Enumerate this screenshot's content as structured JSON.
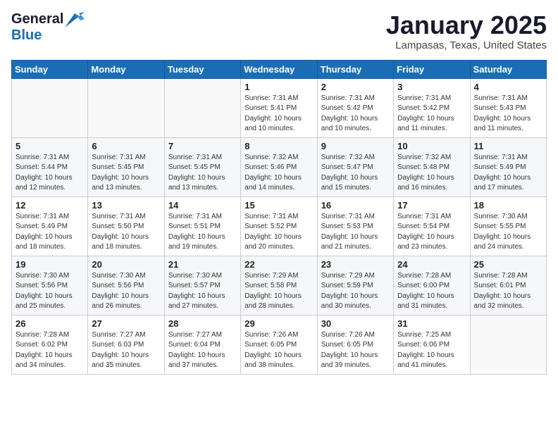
{
  "logo": {
    "general": "General",
    "blue": "Blue"
  },
  "title": "January 2025",
  "subtitle": "Lampasas, Texas, United States",
  "weekdays": [
    "Sunday",
    "Monday",
    "Tuesday",
    "Wednesday",
    "Thursday",
    "Friday",
    "Saturday"
  ],
  "weeks": [
    [
      {
        "day": "",
        "info": ""
      },
      {
        "day": "",
        "info": ""
      },
      {
        "day": "",
        "info": ""
      },
      {
        "day": "1",
        "info": "Sunrise: 7:31 AM\nSunset: 5:41 PM\nDaylight: 10 hours and 10 minutes."
      },
      {
        "day": "2",
        "info": "Sunrise: 7:31 AM\nSunset: 5:42 PM\nDaylight: 10 hours and 10 minutes."
      },
      {
        "day": "3",
        "info": "Sunrise: 7:31 AM\nSunset: 5:42 PM\nDaylight: 10 hours and 11 minutes."
      },
      {
        "day": "4",
        "info": "Sunrise: 7:31 AM\nSunset: 5:43 PM\nDaylight: 10 hours and 11 minutes."
      }
    ],
    [
      {
        "day": "5",
        "info": "Sunrise: 7:31 AM\nSunset: 5:44 PM\nDaylight: 10 hours and 12 minutes."
      },
      {
        "day": "6",
        "info": "Sunrise: 7:31 AM\nSunset: 5:45 PM\nDaylight: 10 hours and 13 minutes."
      },
      {
        "day": "7",
        "info": "Sunrise: 7:31 AM\nSunset: 5:45 PM\nDaylight: 10 hours and 13 minutes."
      },
      {
        "day": "8",
        "info": "Sunrise: 7:32 AM\nSunset: 5:46 PM\nDaylight: 10 hours and 14 minutes."
      },
      {
        "day": "9",
        "info": "Sunrise: 7:32 AM\nSunset: 5:47 PM\nDaylight: 10 hours and 15 minutes."
      },
      {
        "day": "10",
        "info": "Sunrise: 7:32 AM\nSunset: 5:48 PM\nDaylight: 10 hours and 16 minutes."
      },
      {
        "day": "11",
        "info": "Sunrise: 7:31 AM\nSunset: 5:49 PM\nDaylight: 10 hours and 17 minutes."
      }
    ],
    [
      {
        "day": "12",
        "info": "Sunrise: 7:31 AM\nSunset: 5:49 PM\nDaylight: 10 hours and 18 minutes."
      },
      {
        "day": "13",
        "info": "Sunrise: 7:31 AM\nSunset: 5:50 PM\nDaylight: 10 hours and 18 minutes."
      },
      {
        "day": "14",
        "info": "Sunrise: 7:31 AM\nSunset: 5:51 PM\nDaylight: 10 hours and 19 minutes."
      },
      {
        "day": "15",
        "info": "Sunrise: 7:31 AM\nSunset: 5:52 PM\nDaylight: 10 hours and 20 minutes."
      },
      {
        "day": "16",
        "info": "Sunrise: 7:31 AM\nSunset: 5:53 PM\nDaylight: 10 hours and 21 minutes."
      },
      {
        "day": "17",
        "info": "Sunrise: 7:31 AM\nSunset: 5:54 PM\nDaylight: 10 hours and 23 minutes."
      },
      {
        "day": "18",
        "info": "Sunrise: 7:30 AM\nSunset: 5:55 PM\nDaylight: 10 hours and 24 minutes."
      }
    ],
    [
      {
        "day": "19",
        "info": "Sunrise: 7:30 AM\nSunset: 5:56 PM\nDaylight: 10 hours and 25 minutes."
      },
      {
        "day": "20",
        "info": "Sunrise: 7:30 AM\nSunset: 5:56 PM\nDaylight: 10 hours and 26 minutes."
      },
      {
        "day": "21",
        "info": "Sunrise: 7:30 AM\nSunset: 5:57 PM\nDaylight: 10 hours and 27 minutes."
      },
      {
        "day": "22",
        "info": "Sunrise: 7:29 AM\nSunset: 5:58 PM\nDaylight: 10 hours and 28 minutes."
      },
      {
        "day": "23",
        "info": "Sunrise: 7:29 AM\nSunset: 5:59 PM\nDaylight: 10 hours and 30 minutes."
      },
      {
        "day": "24",
        "info": "Sunrise: 7:28 AM\nSunset: 6:00 PM\nDaylight: 10 hours and 31 minutes."
      },
      {
        "day": "25",
        "info": "Sunrise: 7:28 AM\nSunset: 6:01 PM\nDaylight: 10 hours and 32 minutes."
      }
    ],
    [
      {
        "day": "26",
        "info": "Sunrise: 7:28 AM\nSunset: 6:02 PM\nDaylight: 10 hours and 34 minutes."
      },
      {
        "day": "27",
        "info": "Sunrise: 7:27 AM\nSunset: 6:03 PM\nDaylight: 10 hours and 35 minutes."
      },
      {
        "day": "28",
        "info": "Sunrise: 7:27 AM\nSunset: 6:04 PM\nDaylight: 10 hours and 37 minutes."
      },
      {
        "day": "29",
        "info": "Sunrise: 7:26 AM\nSunset: 6:05 PM\nDaylight: 10 hours and 38 minutes."
      },
      {
        "day": "30",
        "info": "Sunrise: 7:26 AM\nSunset: 6:05 PM\nDaylight: 10 hours and 39 minutes."
      },
      {
        "day": "31",
        "info": "Sunrise: 7:25 AM\nSunset: 6:06 PM\nDaylight: 10 hours and 41 minutes."
      },
      {
        "day": "",
        "info": ""
      }
    ]
  ]
}
